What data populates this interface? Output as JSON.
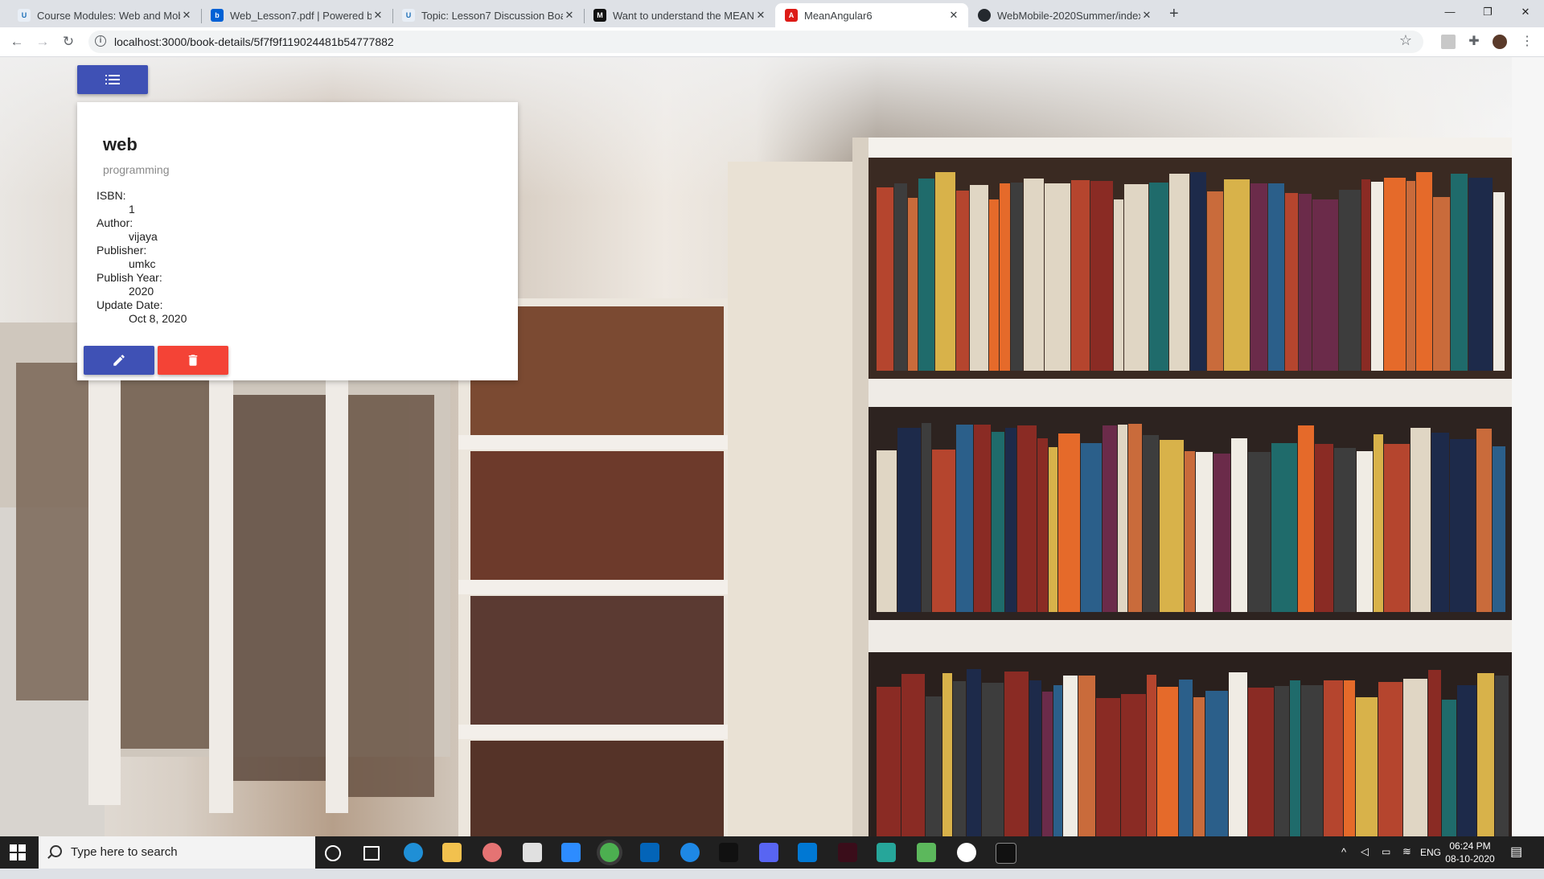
{
  "browser": {
    "tabs": [
      {
        "title": "Course Modules: Web and Mobil",
        "active": false,
        "favicon": "umkc-icon"
      },
      {
        "title": "Web_Lesson7.pdf | Powered by B",
        "active": false,
        "favicon": "box-icon"
      },
      {
        "title": "Topic: Lesson7 Discussion Board",
        "active": false,
        "favicon": "umkc-icon"
      },
      {
        "title": "Want to understand the MEAN S",
        "active": false,
        "favicon": "medium-icon"
      },
      {
        "title": "MeanAngular6",
        "active": true,
        "favicon": "angular-icon"
      },
      {
        "title": "WebMobile-2020Summer/index.",
        "active": false,
        "favicon": "github-icon"
      }
    ],
    "url": "localhost:3000/book-details/5f7f9f119024481b54777882"
  },
  "book": {
    "title": "web",
    "subtitle": "programming",
    "fields": [
      {
        "label": "ISBN:",
        "value": "1"
      },
      {
        "label": "Author:",
        "value": "vijaya"
      },
      {
        "label": "Publisher:",
        "value": "umkc"
      },
      {
        "label": "Publish Year:",
        "value": "2020"
      },
      {
        "label": "Update Date:",
        "value": "Oct 8, 2020"
      }
    ]
  },
  "colors": {
    "primary": "#3f51b5",
    "warn": "#f44336"
  },
  "taskbar": {
    "search_placeholder": "Type here to search",
    "language": "ENG",
    "time": "06:24 PM",
    "date": "08-10-2020"
  }
}
